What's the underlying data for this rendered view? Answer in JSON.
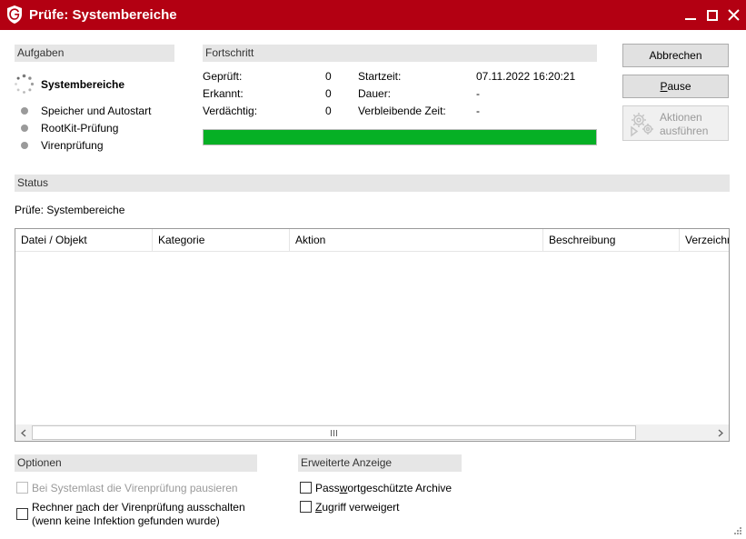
{
  "window": {
    "title": "Prüfe: Systembereiche",
    "logo_icon": "gdata-shield-icon",
    "accent_color": "#b30012"
  },
  "tasks": {
    "header": "Aufgaben",
    "current": "Systembereiche",
    "items": [
      {
        "label": "Speicher und Autostart"
      },
      {
        "label": "RootKit-Prüfung"
      },
      {
        "label": "Virenprüfung"
      }
    ]
  },
  "progress": {
    "header": "Fortschritt",
    "checked_label": "Geprüft:",
    "checked_value": "0",
    "detected_label": "Erkannt:",
    "detected_value": "0",
    "suspicious_label": "Verdächtig:",
    "suspicious_value": "0",
    "start_label": "Startzeit:",
    "start_value": "07.11.2022 16:20:21",
    "duration_label": "Dauer:",
    "duration_value": "-",
    "remaining_label": "Verbleibende Zeit:",
    "remaining_value": "-",
    "bar_fraction": 1.0,
    "bar_color": "#06b025"
  },
  "buttons": {
    "cancel": "Abbrechen",
    "pause_hotkey": "P",
    "pause_rest": "ause",
    "actions_line1": "Aktionen",
    "actions_line2": "ausführen"
  },
  "status": {
    "header": "Status",
    "text": "Prüfe: Systembereiche"
  },
  "table": {
    "columns": [
      "Datei / Objekt",
      "Kategorie",
      "Aktion",
      "Beschreibung",
      "Verzeichni"
    ],
    "rows": []
  },
  "options": {
    "header": "Optionen",
    "pause_on_load": "Bei Systemlast die Virenprüfung pausieren",
    "shutdown_pre": "Rechner ",
    "shutdown_hotkey": "n",
    "shutdown_post": "ach der Virenprüfung ausschalten",
    "shutdown_line2": "(wenn keine Infektion gefunden wurde)"
  },
  "advanced": {
    "header": "Erweiterte Anzeige",
    "archives_pre": "Pass",
    "archives_hotkey": "w",
    "archives_post": "ortgeschützte Archive",
    "denied_hotkey": "Z",
    "denied_post": "ugriff verweigert"
  }
}
